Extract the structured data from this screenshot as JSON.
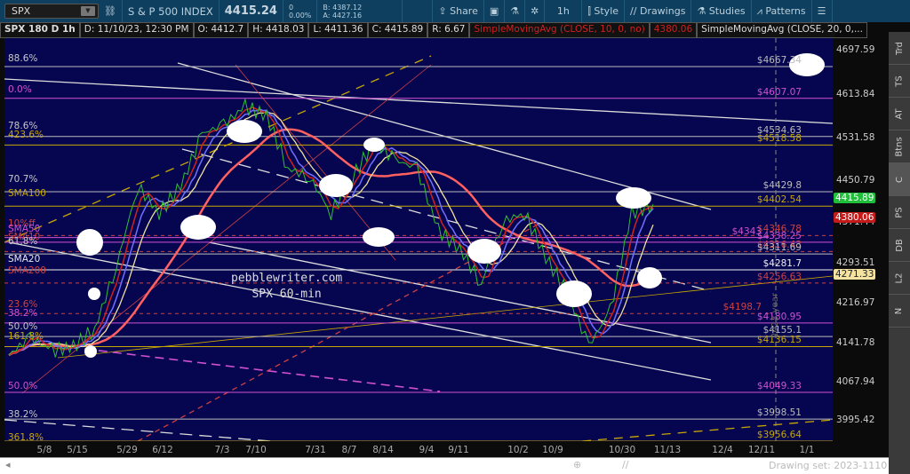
{
  "header": {
    "symbol": "SPX",
    "name": "S & P 500 INDEX",
    "last": "4415.24",
    "change": "0",
    "change_pct": "0.00%",
    "bid": "B: 4387.12",
    "ask": "A: 4427.16",
    "share": "Share",
    "interval": "1h",
    "style": "Style",
    "drawings": "Drawings",
    "studies": "Studies",
    "patterns": "Patterns"
  },
  "info": {
    "title": "SPX 180 D 1h",
    "date": "D: 11/10/23, 12:30 PM",
    "open": "O: 4412.7",
    "high": "H: 4418.03",
    "low": "L: 4411.36",
    "close": "C: 4415.89",
    "range": "R: 6.67",
    "sma10": "SimpleMovingAvg (CLOSE, 10, 0, no)",
    "sma10_val": "4380.06",
    "sma20": "SimpleMovingAvg (CLOSE, 20, 0,..."
  },
  "price_ticks": [
    "4697.59",
    "4613.84",
    "4531.58",
    "4450.79",
    "4371.44",
    "4293.51",
    "4216.97",
    "4141.78",
    "4067.94",
    "3995.42"
  ],
  "badges": [
    {
      "text": "4415.89",
      "price": 4415.89,
      "bg": "#1fbf3a",
      "fg": "#fff"
    },
    {
      "text": "4380.06",
      "price": 4380.06,
      "bg": "#c41a1a",
      "fg": "#fff"
    },
    {
      "text": "4271.33",
      "price": 4271.33,
      "bg": "#f4e3a0",
      "fg": "#222"
    }
  ],
  "left_labels": [
    {
      "text": "88.6%",
      "price": 4680,
      "color": "#c8c8c8"
    },
    {
      "text": "0.0%",
      "price": 4622,
      "color": "#d050d0"
    },
    {
      "text": "78.6%",
      "price": 4552,
      "color": "#c8c8c8"
    },
    {
      "text": "423.6%",
      "price": 4536,
      "color": "#c8a800"
    },
    {
      "text": "70.7%",
      "price": 4452,
      "color": "#c8c8c8"
    },
    {
      "text": "SMA100",
      "price": 4424,
      "color": "#c8a800"
    },
    {
      "text": "10%ff",
      "price": 4368,
      "color": "#d04040"
    },
    {
      "text": "SMA50",
      "price": 4358,
      "color": "#d050d0"
    },
    {
      "text": "SMA10",
      "price": 4342,
      "color": "#d04040"
    },
    {
      "text": "61.8%",
      "price": 4334,
      "color": "#c8c8c8"
    },
    {
      "text": "SMA20",
      "price": 4300,
      "color": "#e8e8e8"
    },
    {
      "text": "SMA200",
      "price": 4279,
      "color": "#d04040"
    },
    {
      "text": "23.6%",
      "price": 4215,
      "color": "#d04040"
    },
    {
      "text": "38.2%",
      "price": 4198,
      "color": "#d050d0"
    },
    {
      "text": "50.0%",
      "price": 4172,
      "color": "#c8c8c8"
    },
    {
      "text": "161.8%",
      "price": 4153,
      "color": "#c8a800"
    },
    {
      "text": "50.0%",
      "price": 4060,
      "color": "#d050d0"
    },
    {
      "text": "38.2%",
      "price": 4005,
      "color": "#c8c8c8"
    },
    {
      "text": "361.8%",
      "price": 3962,
      "color": "#c8a800"
    }
  ],
  "right_labels": [
    {
      "text": "$4667.34",
      "price": 4667.34,
      "color": "#bbb"
    },
    {
      "text": "$4607.07",
      "price": 4607.07,
      "color": "#d050d0"
    },
    {
      "text": "$4534.63",
      "price": 4534.63,
      "color": "#bbb"
    },
    {
      "text": "$4518.58",
      "price": 4518.58,
      "color": "#c8a800"
    },
    {
      "text": "$4429.8",
      "price": 4429.8,
      "color": "#bbb"
    },
    {
      "text": "$4402.54",
      "price": 4402.54,
      "color": "#c8a800"
    },
    {
      "text": "$4346.78",
      "price": 4346.78,
      "color": "#d04040"
    },
    {
      "text": "$4343",
      "price": 4343,
      "color": "#d050d0",
      "left": true
    },
    {
      "text": "$4338.25",
      "price": 4334,
      "color": "#d050d0"
    },
    {
      "text": "$4316.43",
      "price": 4316.43,
      "color": "#d04040"
    },
    {
      "text": "$4311.69",
      "price": 4311.69,
      "color": "#bbb"
    },
    {
      "text": "$4281.7",
      "price": 4281.7,
      "color": "#eee"
    },
    {
      "text": "$4256.63",
      "price": 4256.63,
      "color": "#d04040"
    },
    {
      "text": "$4198.7",
      "price": 4198.7,
      "color": "#d04040",
      "left": true
    },
    {
      "text": "$4180.95",
      "price": 4180.95,
      "color": "#d050d0"
    },
    {
      "text": "$4155.1",
      "price": 4155.1,
      "color": "#bbb"
    },
    {
      "text": "$4136.15",
      "price": 4136.15,
      "color": "#c8a800"
    },
    {
      "text": "$4049.33",
      "price": 4049.33,
      "color": "#d050d0"
    },
    {
      "text": "$3998.51",
      "price": 3998.51,
      "color": "#bbb"
    },
    {
      "text": "$3956.64",
      "price": 3956.64,
      "color": "#c8a800"
    }
  ],
  "watermark": [
    "pebblewriter.com",
    "SPX 60-min"
  ],
  "year_marker": "2023 year",
  "dates": [
    "5/8",
    "5/15",
    "5/29",
    "6/12",
    "7/3",
    "7/10",
    "7/31",
    "8/7",
    "8/14",
    "9/4",
    "9/11",
    "10/2",
    "10/9",
    "10/30",
    "11/13",
    "12/4",
    "12/11",
    "1/1"
  ],
  "side_tabs": [
    "Trd",
    "TS",
    "AT",
    "Btns",
    "C",
    "PS",
    "DB",
    "L2",
    "N"
  ],
  "drawing_set": "Drawing set: 2023-1110",
  "price_series": [
    4120,
    4154,
    4128,
    4136,
    4170,
    4288,
    4440,
    4390,
    4440,
    4540,
    4557,
    4591,
    4574,
    4474,
    4457,
    4390,
    4457,
    4524,
    4490,
    4474,
    4356,
    4322,
    4255,
    4373,
    4390,
    4305,
    4238,
    4137,
    4204,
    4390,
    4406
  ]
}
